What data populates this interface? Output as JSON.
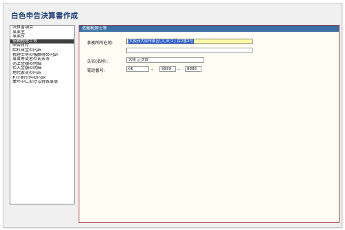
{
  "app": {
    "title": "白色申告決算書作成"
  },
  "sidebar": {
    "items": [
      {
        "label": "決算書項目",
        "selected": false
      },
      {
        "label": "事業主",
        "selected": false
      },
      {
        "label": "事業所",
        "selected": false
      },
      {
        "label": "依頼税理士等",
        "selected": true
      },
      {
        "label": "申告日付",
        "selected": false
      },
      {
        "label": "給料賃金の内訳",
        "selected": false
      },
      {
        "label": "税理士等の報酬等の内訳",
        "selected": false
      },
      {
        "label": "事業専従者の氏名等",
        "selected": false
      },
      {
        "label": "売上金額の明細",
        "selected": false
      },
      {
        "label": "仕入金額の明細",
        "selected": false
      },
      {
        "label": "地代家賃の内訳",
        "selected": false
      },
      {
        "label": "利子割引料の内訳",
        "selected": false
      },
      {
        "label": "本年中における特殊事情",
        "selected": false
      }
    ]
  },
  "panel": {
    "header": "依頼税理士等",
    "fields": {
      "office_address": {
        "label": "事務所所在地:",
        "value": "大阪府大阪市東区〇〇町1丁目2番3号",
        "value_line2": ""
      },
      "name": {
        "label": "氏名(名称):",
        "value": "大阪 正次郎"
      },
      "phone": {
        "label": "電話番号:",
        "part1": "06",
        "separator1": "–",
        "part2": "9999",
        "separator2": "–",
        "part3": "8888"
      }
    }
  },
  "colors": {
    "title": "#1f3f7a",
    "panel_header": "#3a6fa6",
    "panel_border": "#a33a35",
    "selected_item": "#3d3d3d",
    "active_input": "#fffba8",
    "selection": "#2b5fd6"
  }
}
